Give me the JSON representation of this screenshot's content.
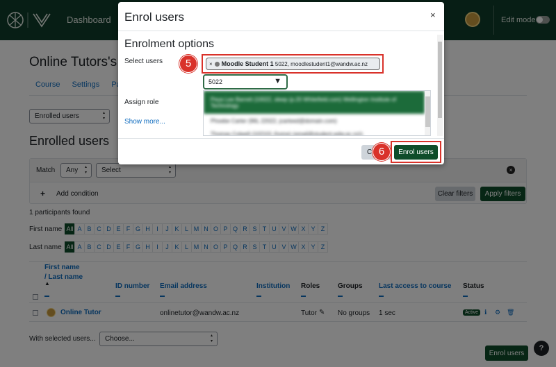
{
  "navbar": {
    "dashboard": "Dashboard",
    "edit_mode": "Edit mode"
  },
  "course": {
    "title": "Online Tutors's",
    "tabs": [
      "Course",
      "Settings",
      "Par"
    ]
  },
  "participants": {
    "view_select": "Enrolled users",
    "heading": "Enrolled users",
    "filter": {
      "match_label": "Match",
      "match_value": "Any",
      "select_value": "Select",
      "add_condition": "Add condition",
      "clear_filters": "Clear filters",
      "apply_filters": "Apply filters"
    },
    "found": "1 participants found",
    "first_name_label": "First name",
    "last_name_label": "Last name",
    "letters": [
      "All",
      "A",
      "B",
      "C",
      "D",
      "E",
      "F",
      "G",
      "H",
      "I",
      "J",
      "K",
      "L",
      "M",
      "N",
      "O",
      "P",
      "Q",
      "R",
      "S",
      "T",
      "U",
      "V",
      "W",
      "X",
      "Y",
      "Z"
    ],
    "columns": {
      "first_name": "First name",
      "last_name": "/ Last name",
      "id_number": "ID number",
      "email": "Email address",
      "institution": "Institution",
      "roles": "Roles",
      "groups": "Groups",
      "last_access": "Last access to course",
      "status": "Status"
    },
    "rows": [
      {
        "name": "Online Tutor",
        "email": "onlinetutor@wandw.ac.nz",
        "role": "Tutor",
        "groups": "No groups",
        "last_access": "1 sec",
        "status": "Active"
      }
    ],
    "with_selected_label": "With selected users...",
    "with_selected_value": "Choose...",
    "enrol_users_button": "Enrol users",
    "help": "?"
  },
  "modal": {
    "title": "Enrol users",
    "close": "×",
    "section_title": "Enrolment options",
    "select_users_label": "Select users",
    "assign_role_label": "Assign role",
    "show_more": "Show more...",
    "selected_chip": {
      "remove": "×",
      "name": "Moodle Student 1",
      "detail": "5022, moodlestudent1@wandw.ac.nz"
    },
    "search_value": "5022",
    "suggestions": [
      "Peya Lee Barrett (10022, sleep (p.20 Whitefield.com) Wellington Institute of Technology",
      "Phoebe Carter (96L 22022, jcarteed@domain.com)",
      "Thomas Colwell (102101 (home) (email@student.wdw.ac.nz))"
    ],
    "cancel_label": "Cancel",
    "enrol_button": "Enrol users"
  },
  "callouts": {
    "step5": "5",
    "step6": "6"
  },
  "colors": {
    "navbar": "#0f3c2b",
    "primary_button": "#0f4d2a",
    "callout": "#d9322a",
    "link": "#0f6cbf"
  }
}
